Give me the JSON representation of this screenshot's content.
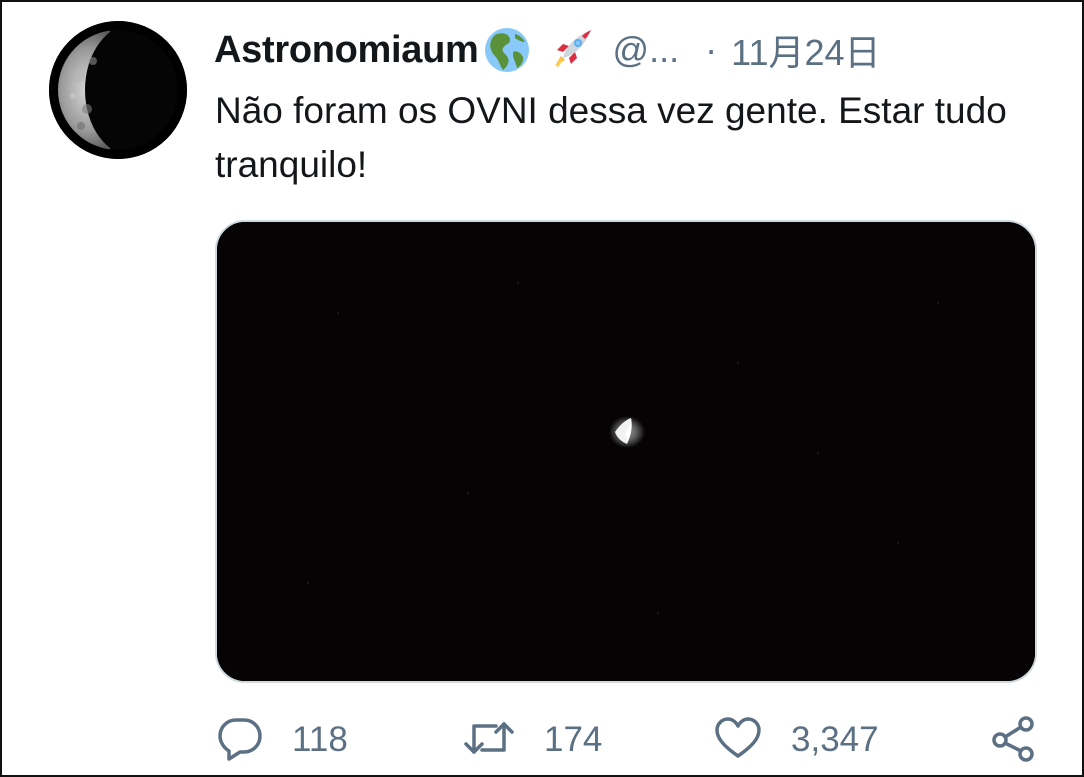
{
  "tweet": {
    "avatar_icon": "moon-avatar-icon",
    "display_name": "Astronomiaum",
    "name_emojis": [
      "globe-americas-emoji",
      "rocket-emoji"
    ],
    "handle": "@...",
    "separator": "·",
    "date": "11月24日",
    "text": "Não foram os OVNI dessa vez gente. Estar tudo tranquilo!",
    "media": {
      "icon": "night-sky-photo"
    }
  },
  "actions": {
    "reply": {
      "icon": "reply-icon",
      "count": "118"
    },
    "retweet": {
      "icon": "retweet-icon",
      "count": "174"
    },
    "like": {
      "icon": "heart-icon",
      "count": "3,347"
    },
    "share": {
      "icon": "share-icon"
    }
  },
  "colors": {
    "text_primary": "#14171a",
    "text_secondary": "#5b7083",
    "media_border": "#cfd9de"
  }
}
